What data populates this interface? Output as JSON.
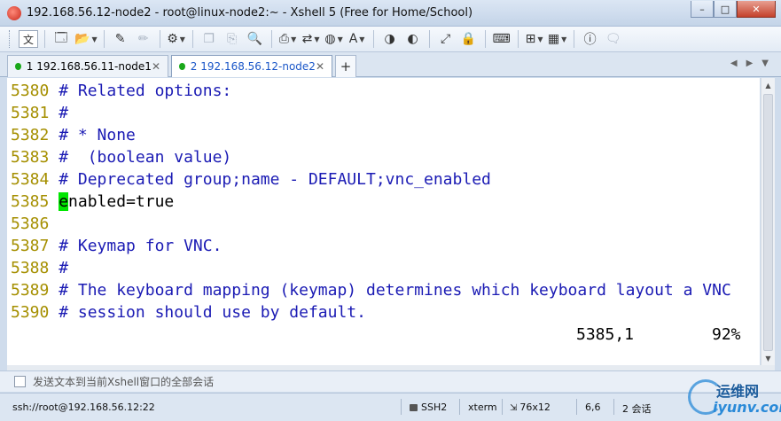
{
  "window": {
    "title": "192.168.56.12-node2 - root@linux-node2:~ - Xshell 5 (Free for Home/School)",
    "controls": {
      "minimize": "–",
      "maximize": "□",
      "close": "✕"
    }
  },
  "toolbar": {
    "lang_label": "文",
    "icons": [
      "new-session-icon",
      "open-folder-icon",
      "pen-icon",
      "eraser-icon",
      "properties-icon",
      "copy-icon",
      "paste-icon",
      "find-icon",
      "print-icon",
      "transfer-icon",
      "globe-icon",
      "font-icon",
      "xftp-icon",
      "xshell-icon",
      "fullscreen-icon",
      "lock-icon",
      "keyboard-icon",
      "add-icon",
      "layout-icon",
      "help-icon",
      "chat-icon"
    ]
  },
  "tabs": [
    {
      "label": "1 192.168.56.11-node1",
      "active": false,
      "status_color": "#1aa81a"
    },
    {
      "label": "2 192.168.56.12-node2",
      "active": true,
      "status_color": "#1aa81a"
    }
  ],
  "terminal": {
    "lines": [
      {
        "num": "5380",
        "text": "# Related options:",
        "type": "comment"
      },
      {
        "num": "5381",
        "text": "#",
        "type": "comment"
      },
      {
        "num": "5382",
        "text": "# * None",
        "type": "comment"
      },
      {
        "num": "5383",
        "text": "#  (boolean value)",
        "type": "comment"
      },
      {
        "num": "5384",
        "text": "# Deprecated group;name - DEFAULT;vnc_enabled",
        "type": "comment"
      },
      {
        "num": "5385",
        "cursor_char": "e",
        "text": "nabled=true",
        "type": "text"
      },
      {
        "num": "5386",
        "text": "",
        "type": "text"
      },
      {
        "num": "5387",
        "text": "# Keymap for VNC.",
        "type": "comment"
      },
      {
        "num": "5388",
        "text": "#",
        "type": "comment"
      },
      {
        "num": "5389",
        "text": "# The keyboard mapping (keymap) determines which keyboard layout a VNC",
        "type": "comment"
      },
      {
        "num": "5390",
        "text": "# session should use by default.",
        "type": "comment"
      }
    ],
    "status_position": "5385,1",
    "status_percent": "92%"
  },
  "sendbar": {
    "text": "发送文本到当前Xshell窗口的全部会话"
  },
  "statusbar": {
    "connection": "ssh://root@192.168.56.12:22",
    "protocol": "SSH2",
    "term": "xterm",
    "size": "76x12",
    "cursor": "6,6",
    "sessions": "2 会话"
  },
  "watermark": {
    "top": "运维网",
    "bottom": "iyunv.com"
  }
}
